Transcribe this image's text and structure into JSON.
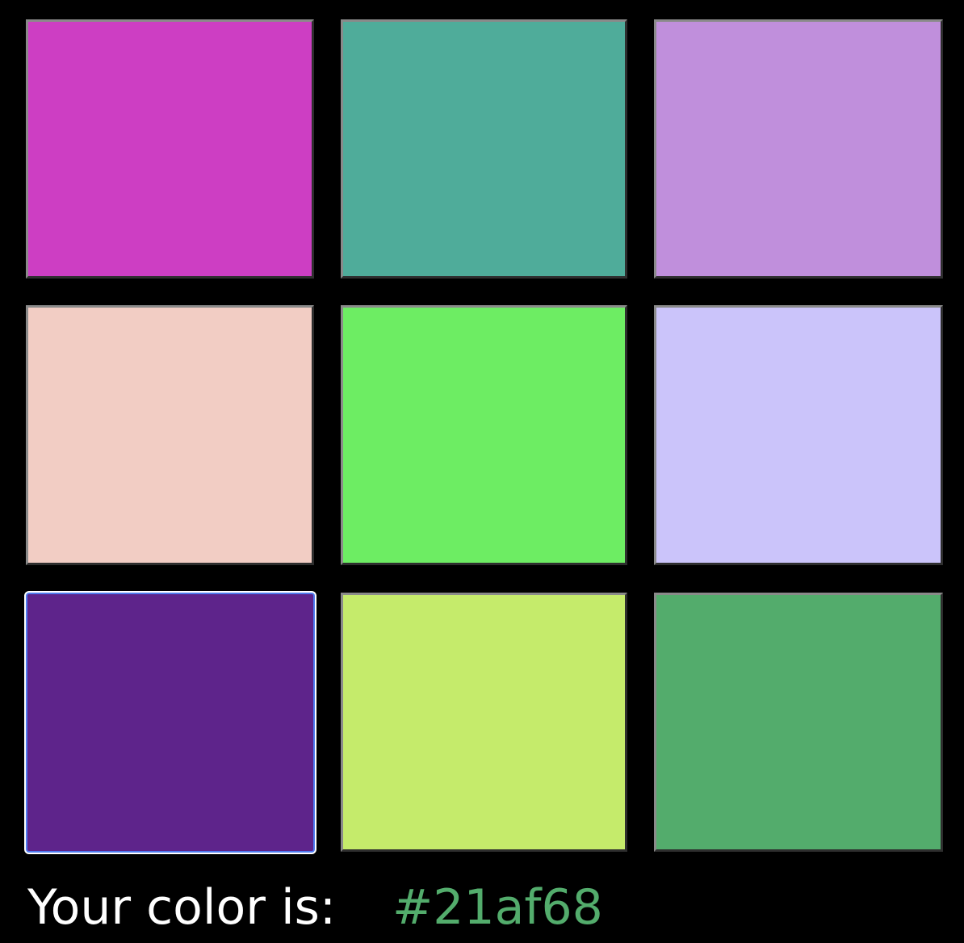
{
  "swatches": [
    {
      "name": "swatch-1",
      "color": "#cd3ec3",
      "focused": false
    },
    {
      "name": "swatch-2",
      "color": "#4fac9a",
      "focused": false
    },
    {
      "name": "swatch-3",
      "color": "#c08fdc",
      "focused": false
    },
    {
      "name": "swatch-4",
      "color": "#f2cdc4",
      "focused": false
    },
    {
      "name": "swatch-5",
      "color": "#6ded63",
      "focused": false
    },
    {
      "name": "swatch-6",
      "color": "#cbc4fa",
      "focused": false
    },
    {
      "name": "swatch-7",
      "color": "#5e248b",
      "focused": true
    },
    {
      "name": "swatch-8",
      "color": "#c5eb6b",
      "focused": false
    },
    {
      "name": "swatch-9",
      "color": "#53ac6c",
      "focused": false
    }
  ],
  "result": {
    "label": "Your color is:",
    "value": "#21af68",
    "value_color": "#53ac6c"
  }
}
